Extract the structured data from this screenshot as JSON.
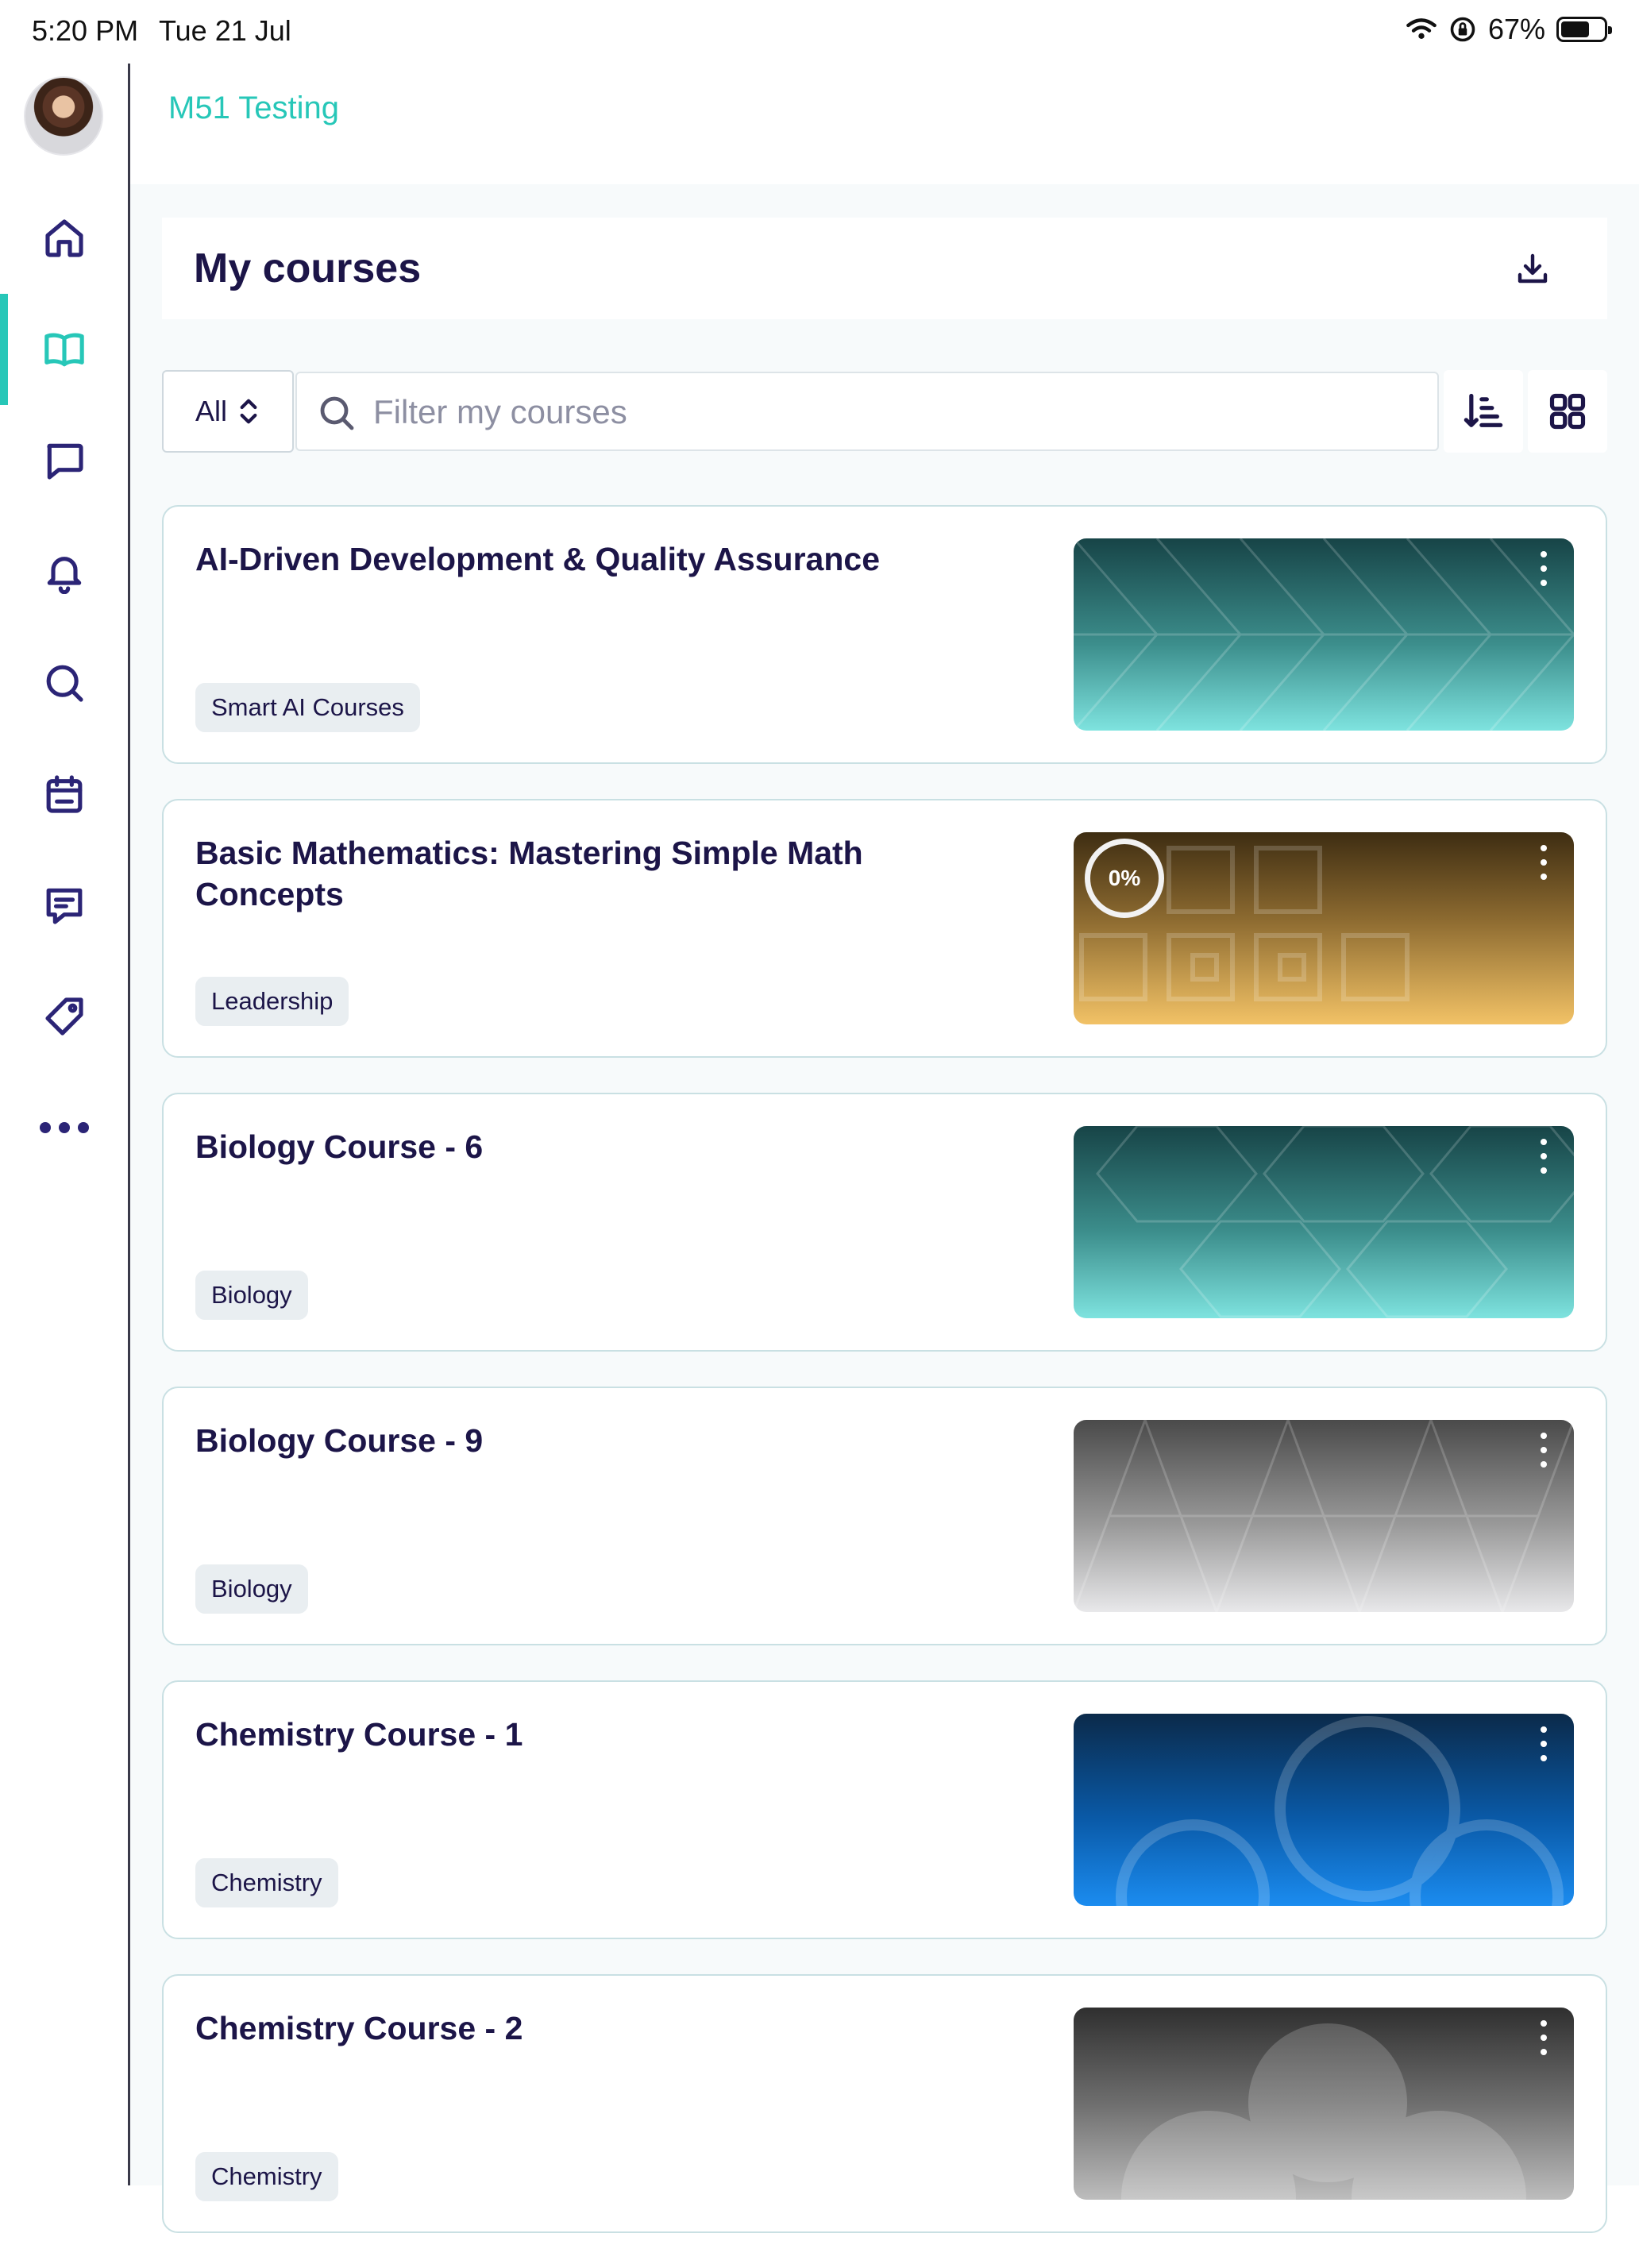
{
  "status_bar": {
    "time": "5:20 PM",
    "date": "Tue 21 Jul",
    "battery": "67%",
    "battery_level": 0.67
  },
  "sidebar": {
    "items": [
      {
        "name": "home-icon",
        "active": false
      },
      {
        "name": "book-icon",
        "active": true
      },
      {
        "name": "chat-bubble-icon",
        "active": false
      },
      {
        "name": "bell-icon",
        "active": false
      },
      {
        "name": "search-icon",
        "active": false
      },
      {
        "name": "calendar-icon",
        "active": false
      },
      {
        "name": "message-icon",
        "active": false
      },
      {
        "name": "tag-icon",
        "active": false
      },
      {
        "name": "more-dots-icon",
        "active": false
      }
    ]
  },
  "header": {
    "org_name": "M51 Testing"
  },
  "page": {
    "title": "My courses",
    "download_icon": "download-icon"
  },
  "filters": {
    "selected": "All",
    "search_placeholder": "Filter my courses",
    "search_value": "",
    "sort_icon": "sort-icon",
    "view_icon": "grid-view-icon"
  },
  "courses": [
    {
      "title": "AI-Driven Development & Quality Assurance",
      "tag": "Smart AI Courses",
      "thumb_color": "teal",
      "progress": null
    },
    {
      "title": "Basic Mathematics: Mastering Simple Math Concepts",
      "tag": "Leadership",
      "thumb_color": "gold",
      "progress": "0%"
    },
    {
      "title": "Biology Course - 6",
      "tag": "Biology",
      "thumb_color": "teal",
      "progress": null
    },
    {
      "title": "Biology Course - 9",
      "tag": "Biology",
      "thumb_color": "gray",
      "progress": null
    },
    {
      "title": "Chemistry Course - 1",
      "tag": "Chemistry",
      "thumb_color": "blue",
      "progress": null
    },
    {
      "title": "Chemistry Course - 2",
      "tag": "Chemistry",
      "thumb_color": "gray",
      "progress": null
    }
  ],
  "colors": {
    "accent": "#27c7b8",
    "primary_text": "#1c1548",
    "nav_icon": "#2b2476"
  }
}
